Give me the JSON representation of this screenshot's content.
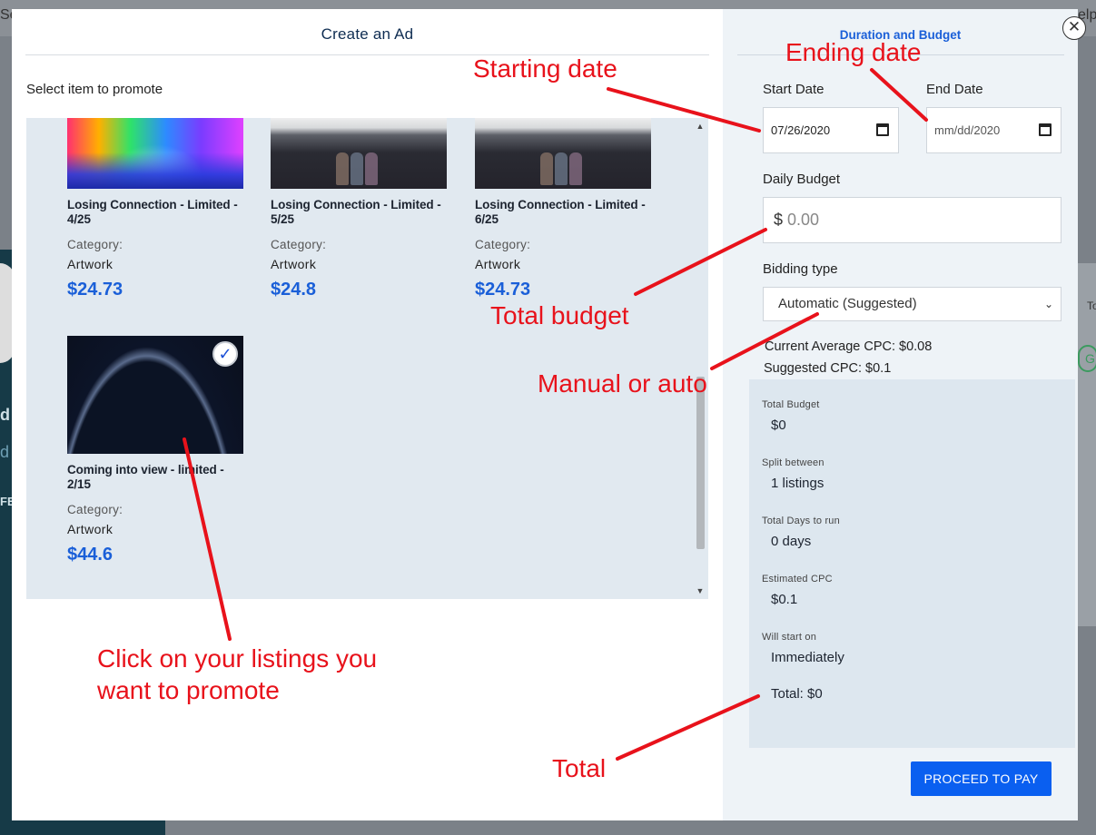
{
  "background": {
    "top_left_fragment": "Se",
    "top_right_fragment": "elp",
    "left_fragments": [
      "d",
      "d",
      "FE"
    ],
    "right_fragments": [
      "To",
      "G"
    ]
  },
  "modal": {
    "left": {
      "title": "Create an Ad",
      "select_label": "Select item to promote",
      "listings": [
        {
          "title": "Losing Connection - Limited - 4/25",
          "category_label": "Category:",
          "category": "Artwork",
          "price": "$24.73",
          "thumbnail": "rainbow-ship",
          "selected": false
        },
        {
          "title": "Losing Connection - Limited - 5/25",
          "category_label": "Category:",
          "category": "Artwork",
          "price": "$24.8",
          "thumbnail": "dusk-figures",
          "selected": false
        },
        {
          "title": "Losing Connection - Limited - 6/25",
          "category_label": "Category:",
          "category": "Artwork",
          "price": "$24.73",
          "thumbnail": "dusk-figures",
          "selected": false
        },
        {
          "title": "Coming into view - limited - 2/15",
          "category_label": "Category:",
          "category": "Artwork",
          "price": "$44.6",
          "thumbnail": "earth-horizon",
          "selected": true
        }
      ],
      "check_glyph": "✓",
      "scroll_up": "▲",
      "scroll_down": "▼"
    },
    "right": {
      "title": "Duration and Budget",
      "close_glyph": "✕",
      "start_date_label": "Start Date",
      "start_date_value": "07/26/2020",
      "end_date_label": "End Date",
      "end_date_value": "mm/dd/2020",
      "daily_budget_label": "Daily Budget",
      "daily_budget_currency": "$",
      "daily_budget_placeholder": "0.00",
      "bidding_type_label": "Bidding type",
      "bidding_type_value": "Automatic (Suggested)",
      "current_avg_cpc": "Current Average CPC: $0.08",
      "suggested_cpc": "Suggested CPC: $0.1",
      "summary": {
        "total_budget_label": "Total Budget",
        "total_budget_value": "$0",
        "split_label": "Split between",
        "split_value": "1 listings",
        "days_label": "Total Days to run",
        "days_value": "0 days",
        "cpc_label": "Estimated CPC",
        "cpc_value": "$0.1",
        "start_label": "Will start on",
        "start_value": "Immediately",
        "total": "Total: $0"
      },
      "proceed_button": "PROCEED TO PAY"
    }
  },
  "annotations": {
    "starting_date": "Starting date",
    "ending_date": "Ending date",
    "total_budget": "Total budget",
    "manual_or_auto": "Manual or auto",
    "click_listings_line1": "Click on your listings you",
    "click_listings_line2": "want to promote",
    "total": "Total",
    "color": "#e8121b"
  },
  "colors": {
    "accent": "#1a5fd8",
    "button": "#0a5ff0",
    "list_background": "#e1e9f0",
    "summary_background": "#dde7ef",
    "annotation": "#e8121b"
  }
}
